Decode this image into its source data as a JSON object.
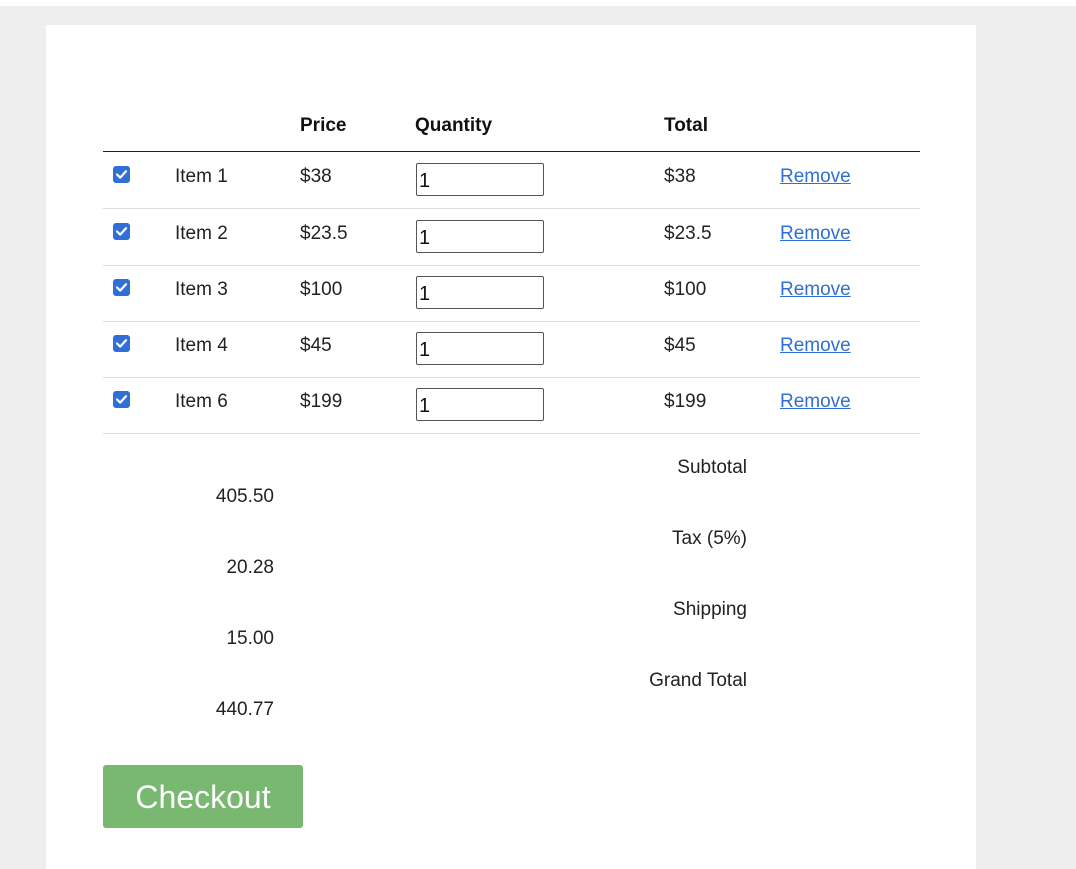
{
  "table": {
    "headers": {
      "select": "",
      "item": "",
      "price": "Price",
      "quantity": "Quantity",
      "total": "Total",
      "action": ""
    },
    "rows": [
      {
        "checked": true,
        "item": "Item 1",
        "price": "$38",
        "quantity": "1",
        "total": "$38",
        "remove_label": "Remove"
      },
      {
        "checked": true,
        "item": "Item 2",
        "price": "$23.5",
        "quantity": "1",
        "total": "$23.5",
        "remove_label": "Remove"
      },
      {
        "checked": true,
        "item": "Item 3",
        "price": "$100",
        "quantity": "1",
        "total": "$100",
        "remove_label": "Remove"
      },
      {
        "checked": true,
        "item": "Item 4",
        "price": "$45",
        "quantity": "1",
        "total": "$45",
        "remove_label": "Remove"
      },
      {
        "checked": true,
        "item": "Item 6",
        "price": "$199",
        "quantity": "1",
        "total": "$199",
        "remove_label": "Remove"
      }
    ]
  },
  "summary": {
    "subtotal_label": "Subtotal",
    "subtotal_value": "405.50",
    "tax_label": "Tax (5%)",
    "tax_value": "20.28",
    "shipping_label": "Shipping",
    "shipping_value": "15.00",
    "grand_total_label": "Grand Total",
    "grand_total_value": "440.77"
  },
  "checkout": {
    "label": "Checkout"
  },
  "colors": {
    "page_background": "#eeeeee",
    "card_background": "#ffffff",
    "checkbox_accent": "#2f6fd6",
    "link": "#2f6fd6",
    "checkout_button": "#79b871"
  },
  "icons": {
    "row_checkbox": "checkmark-icon"
  }
}
